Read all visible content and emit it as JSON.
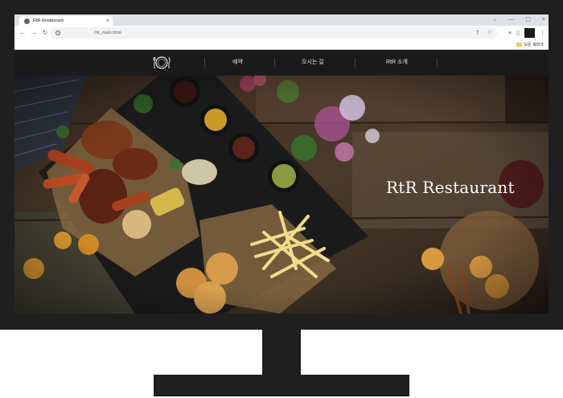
{
  "browser": {
    "tab_title": "RtR Restaurant",
    "tab_close": "×",
    "url": "/rtr_main.html",
    "window_controls": {
      "minimize": "—",
      "maximize": "▢",
      "close": "×",
      "chevron": "⌄"
    },
    "nav": {
      "back": "←",
      "forward": "→",
      "reload": "↻"
    },
    "bookmark_label": "모든 북마크",
    "icons": [
      "info-icon",
      "share-icon",
      "star-icon",
      "extensions-icon",
      "sidepanel-icon",
      "profile-icon",
      "menu-icon"
    ]
  },
  "site": {
    "nav_items": [
      "예약",
      "오시는 길",
      "RtR 소개"
    ],
    "hero_title": "RtR Restaurant"
  },
  "colors": {
    "monitor": "#1f1f1f",
    "nav_background": "#1a1a1a",
    "hero_text": "#ffffff"
  }
}
